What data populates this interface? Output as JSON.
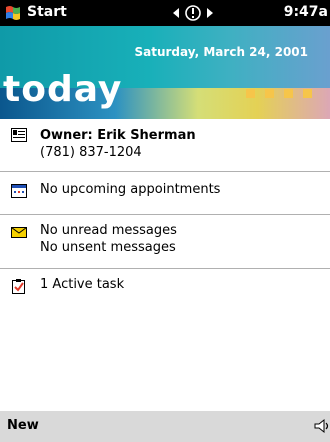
{
  "titlebar": {
    "start_label": "Start",
    "clock": "9:47a"
  },
  "banner": {
    "date": "Saturday, March 24, 2001",
    "today_label": "today"
  },
  "items": {
    "owner": {
      "name": "Owner: Erik Sherman",
      "phone": "(781) 837-1204"
    },
    "calendar": {
      "text": "No upcoming appointments"
    },
    "messages": {
      "unread": "No unread messages",
      "unsent": "No unsent messages"
    },
    "tasks": {
      "text": "1 Active task"
    }
  },
  "menubar": {
    "new_label": "New"
  },
  "colors": {
    "banner_teal": "#18b0b9",
    "accent_yellow": "#f6c54a",
    "titlebar": "#000000",
    "menubar": "#d9d9d9"
  },
  "icons": [
    "start-flag-icon",
    "connectivity-icon",
    "owner-card-icon",
    "calendar-icon",
    "envelope-icon",
    "task-check-icon",
    "speaker-icon"
  ]
}
